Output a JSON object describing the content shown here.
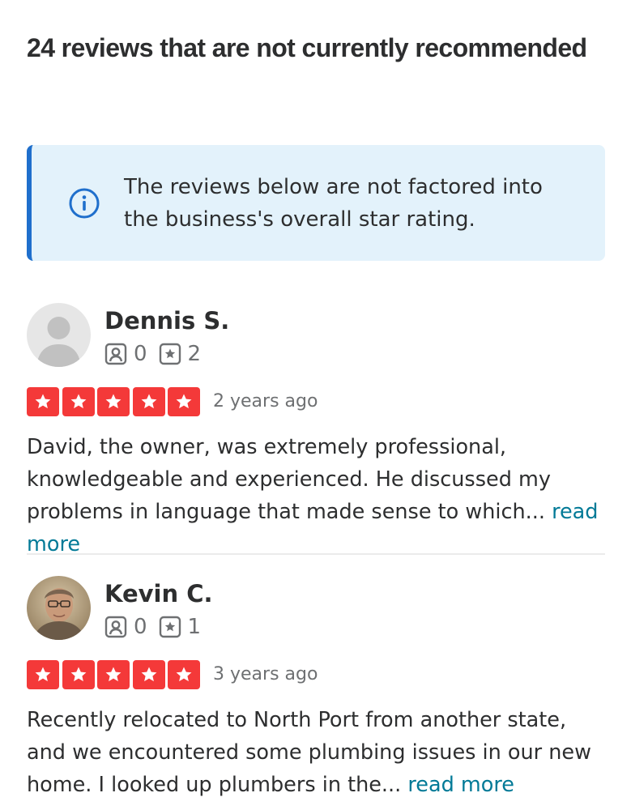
{
  "heading": "24 reviews that are not currently recommended",
  "notice": {
    "text": "The reviews below are not factored into the business's overall star rating."
  },
  "colors": {
    "star_red": "#f43939",
    "info_blue": "#1f6fcc",
    "notice_bg": "#e3f2fb",
    "link_teal": "#027a97"
  },
  "reviews": [
    {
      "name": "Dennis S.",
      "friends": "0",
      "reviews_count": "2",
      "rating": 5,
      "date": "2 years ago",
      "text": "David, the owner, was extremely professional, knowledgeable and experienced. He discussed my problems in language that made sense to which...",
      "read_more": "read more",
      "avatar": "default-user-silhouette"
    },
    {
      "name": "Kevin C.",
      "friends": "0",
      "reviews_count": "1",
      "rating": 5,
      "date": "3 years ago",
      "text": "Recently relocated to North Port from another state, and we encountered some plumbing issues in our new home. I looked up plumbers in the...",
      "read_more": "read more",
      "avatar": "user-photo"
    }
  ]
}
